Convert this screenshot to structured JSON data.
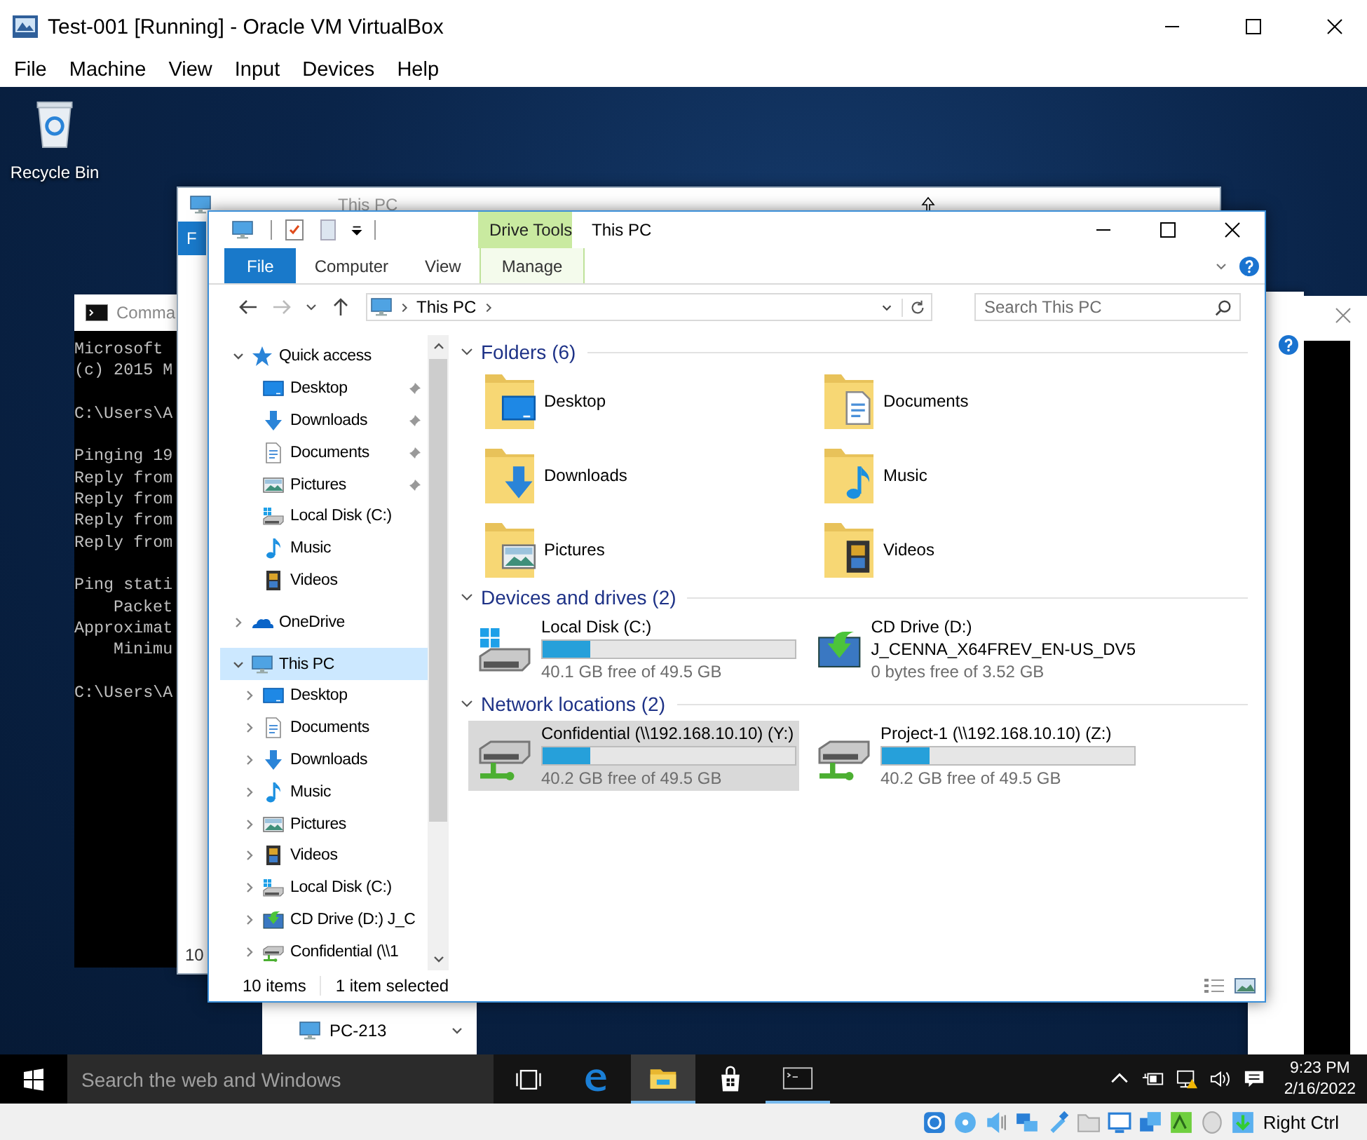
{
  "host": {
    "title": "Test-001 [Running] - Oracle VM VirtualBox",
    "menu": [
      "File",
      "Machine",
      "View",
      "Input",
      "Devices",
      "Help"
    ],
    "status_text": "Right Ctrl"
  },
  "desktop": {
    "icons": [
      {
        "label": "Recycle Bin"
      }
    ]
  },
  "cmd_window": {
    "title": "Comma",
    "lines": [
      {
        "text": "Microsoft",
        "indent": false,
        "gap_before": false
      },
      {
        "text": "(c) 2015 M",
        "indent": false,
        "gap_before": false
      },
      {
        "text": "C:\\Users\\A",
        "indent": false,
        "gap_before": true
      },
      {
        "text": "Pinging 19",
        "indent": false,
        "gap_before": true
      },
      {
        "text": "Reply from",
        "indent": false,
        "gap_before": false
      },
      {
        "text": "Reply from",
        "indent": false,
        "gap_before": false
      },
      {
        "text": "Reply from",
        "indent": false,
        "gap_before": false
      },
      {
        "text": "Reply from",
        "indent": false,
        "gap_before": false
      },
      {
        "text": "Ping stati",
        "indent": false,
        "gap_before": true
      },
      {
        "text": "Packet",
        "indent": true,
        "gap_before": false
      },
      {
        "text": "Approximat",
        "indent": false,
        "gap_before": false
      },
      {
        "text": "Minimu",
        "indent": true,
        "gap_before": false
      },
      {
        "text": "C:\\Users\\A",
        "indent": false,
        "gap_before": true
      }
    ]
  },
  "back_window": {
    "title": "This PC",
    "file_tab": "F",
    "status": "10"
  },
  "network_window": {
    "items": [
      {
        "label": "PC-213",
        "kind": "pc"
      }
    ]
  },
  "explorer": {
    "title": "This PC",
    "context_tab": "Drive Tools",
    "ribbon_tabs": [
      {
        "label": "File",
        "kind": "file"
      },
      {
        "label": "Computer",
        "kind": "plain"
      },
      {
        "label": "View",
        "kind": "plain"
      },
      {
        "label": "Manage",
        "kind": "context"
      }
    ],
    "address": {
      "path": [
        "This PC"
      ]
    },
    "search": {
      "placeholder": "Search This PC"
    },
    "nav": [
      {
        "label": "Quick access",
        "kind": "quick",
        "expanded": true,
        "selected": false,
        "children": [
          {
            "label": "Desktop",
            "kind": "desktop",
            "pinned": true,
            "selected": false
          },
          {
            "label": "Downloads",
            "kind": "downloads",
            "pinned": true,
            "selected": false
          },
          {
            "label": "Documents",
            "kind": "documents",
            "pinned": true,
            "selected": false
          },
          {
            "label": "Pictures",
            "kind": "pictures",
            "pinned": true,
            "selected": false
          },
          {
            "label": "Local Disk (C:)",
            "kind": "disk",
            "pinned": false,
            "selected": false
          },
          {
            "label": "Music",
            "kind": "music",
            "pinned": false,
            "selected": false
          },
          {
            "label": "Videos",
            "kind": "videos",
            "pinned": false,
            "selected": false
          }
        ]
      },
      {
        "label": "OneDrive",
        "kind": "onedrive",
        "expanded": false,
        "selected": false
      },
      {
        "label": "This PC",
        "kind": "pc",
        "expanded": true,
        "selected": true,
        "children": [
          {
            "label": "Desktop",
            "kind": "desktop",
            "expanded": false,
            "selected": false
          },
          {
            "label": "Documents",
            "kind": "documents",
            "expanded": false,
            "selected": false
          },
          {
            "label": "Downloads",
            "kind": "downloads",
            "expanded": false,
            "selected": false
          },
          {
            "label": "Music",
            "kind": "music",
            "expanded": false,
            "selected": false
          },
          {
            "label": "Pictures",
            "kind": "pictures",
            "expanded": false,
            "selected": false
          },
          {
            "label": "Videos",
            "kind": "videos",
            "expanded": false,
            "selected": false
          },
          {
            "label": "Local Disk (C:)",
            "kind": "disk",
            "expanded": false,
            "selected": false
          },
          {
            "label": "CD Drive (D:) J_C",
            "kind": "cd",
            "expanded": false,
            "selected": false
          },
          {
            "label": "Confidential (\\\\1",
            "kind": "network",
            "expanded": false,
            "selected": false
          }
        ]
      }
    ],
    "sections": [
      {
        "heading": "Folders (6)",
        "kind": "folders",
        "expanded": true,
        "items": [
          {
            "label": "Desktop",
            "kind": "desktop"
          },
          {
            "label": "Documents",
            "kind": "documents"
          },
          {
            "label": "Downloads",
            "kind": "downloads"
          },
          {
            "label": "Music",
            "kind": "music"
          },
          {
            "label": "Pictures",
            "kind": "pictures"
          },
          {
            "label": "Videos",
            "kind": "videos"
          }
        ]
      },
      {
        "heading": "Devices and drives (2)",
        "kind": "drives",
        "expanded": true,
        "items": [
          {
            "label": "Local Disk (C:)",
            "kind": "disk",
            "level": 0.19,
            "free": "40.1 GB free of 49.5 GB",
            "selected": false
          },
          {
            "label": "CD Drive (D:)",
            "sublabel": "J_CENNA_X64FREV_EN-US_DV5",
            "kind": "cd",
            "free": "0 bytes free of 3.52 GB",
            "selected": false
          }
        ]
      },
      {
        "heading": "Network locations (2)",
        "kind": "drives",
        "expanded": true,
        "items": [
          {
            "label": "Confidential (\\\\192.168.10.10) (Y:)",
            "kind": "network",
            "level": 0.19,
            "free": "40.2 GB free of 49.5 GB",
            "selected": true
          },
          {
            "label": "Project-1 (\\\\192.168.10.10) (Z:)",
            "kind": "network",
            "level": 0.19,
            "free": "40.2 GB free of 49.5 GB",
            "selected": false
          }
        ]
      }
    ],
    "status": {
      "count": "10 items",
      "selection": "1 item selected"
    }
  },
  "taskbar": {
    "search_placeholder": "Search the web and Windows",
    "apps": [
      {
        "kind": "taskview",
        "open": false,
        "selected": false
      },
      {
        "kind": "edge",
        "open": false,
        "selected": false
      },
      {
        "kind": "explorer",
        "open": true,
        "selected": true
      },
      {
        "kind": "store",
        "open": false,
        "selected": false
      },
      {
        "kind": "cmd",
        "open": true,
        "selected": false
      }
    ],
    "time": "9:23 PM",
    "date": "2/16/2022"
  }
}
